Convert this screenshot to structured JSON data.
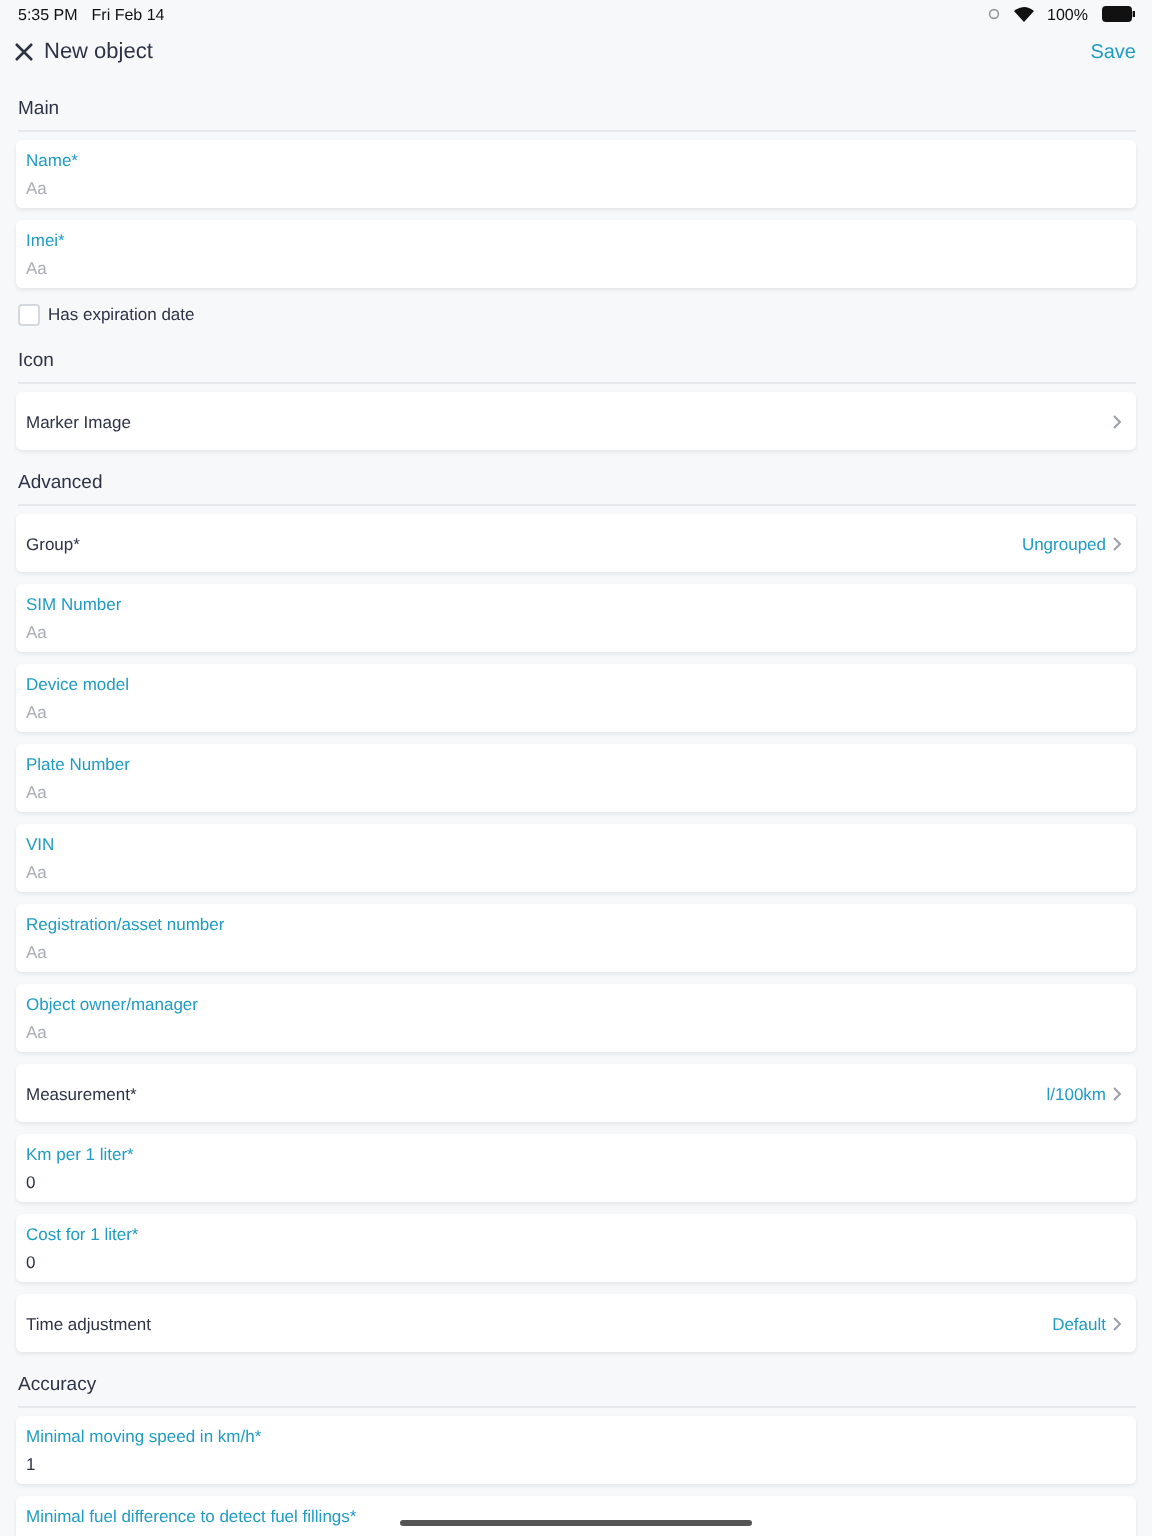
{
  "status_bar": {
    "time": "5:35 PM",
    "date": "Fri Feb 14",
    "battery": "100%"
  },
  "header": {
    "title": "New object",
    "action": "Save"
  },
  "sections": [
    {
      "title": "Main",
      "items": [
        {
          "kind": "field",
          "label": "Name*",
          "placeholder": "Aa"
        },
        {
          "kind": "field",
          "label": "Imei*",
          "placeholder": "Aa"
        },
        {
          "kind": "checkbox",
          "label": "Has expiration date",
          "checked": false
        }
      ]
    },
    {
      "title": "Icon",
      "items": [
        {
          "kind": "select",
          "label": "Marker Image"
        }
      ]
    },
    {
      "title": "Advanced",
      "items": [
        {
          "kind": "select",
          "label": "Group*",
          "value": "Ungrouped"
        },
        {
          "kind": "field",
          "label": "SIM Number",
          "placeholder": "Aa"
        },
        {
          "kind": "field",
          "label": "Device model",
          "placeholder": "Aa"
        },
        {
          "kind": "field",
          "label": "Plate Number",
          "placeholder": "Aa"
        },
        {
          "kind": "field",
          "label": "VIN",
          "placeholder": "Aa"
        },
        {
          "kind": "field",
          "label": "Registration/asset number",
          "placeholder": "Aa"
        },
        {
          "kind": "field",
          "label": "Object owner/manager",
          "placeholder": "Aa"
        },
        {
          "kind": "select",
          "label": "Measurement*",
          "value": "l/100km"
        },
        {
          "kind": "field",
          "label": "Km per 1 liter*",
          "value": "0"
        },
        {
          "kind": "field",
          "label": "Cost for 1 liter*",
          "value": "0"
        },
        {
          "kind": "select",
          "label": "Time adjustment",
          "value": "Default"
        }
      ]
    },
    {
      "title": "Accuracy",
      "items": [
        {
          "kind": "field",
          "label": "Minimal moving speed in km/h*",
          "value": "1"
        },
        {
          "kind": "field",
          "label": "Minimal fuel difference to detect fuel fillings*"
        }
      ]
    }
  ]
}
